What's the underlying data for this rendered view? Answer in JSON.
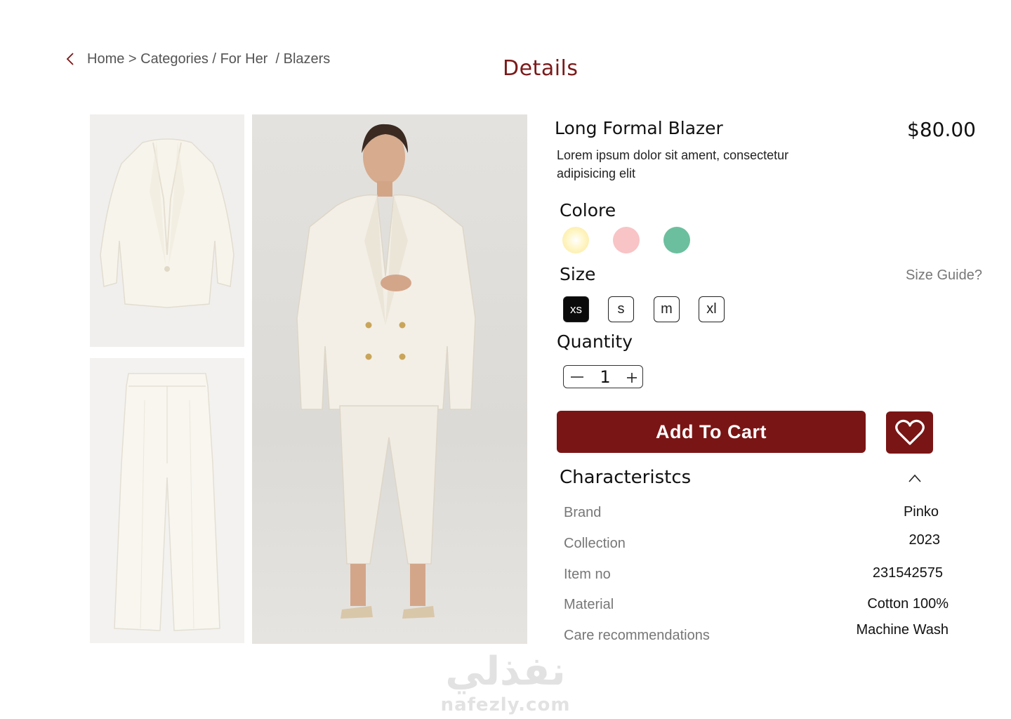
{
  "breadcrumb": {
    "items": [
      "Home >",
      "Categories /",
      "For Her",
      "/ Blazers"
    ]
  },
  "page": {
    "title": "Details"
  },
  "product": {
    "name": "Long Formal Blazer",
    "price": "$80.00",
    "description": "Lorem ipsum dolor sit ament, consectetur adipisicing elit"
  },
  "colors": {
    "label": "Colore",
    "swatches": [
      "#fdf0b0",
      "#f8c4c6",
      "#6cbf9e"
    ]
  },
  "sizes": {
    "label": "Size",
    "guide_link": "Size Guide?",
    "options": [
      "xs",
      "s",
      "m",
      "xl"
    ],
    "selected": "xs"
  },
  "quantity": {
    "label": "Quantity",
    "value": "1"
  },
  "actions": {
    "add_to_cart": "Add To Cart"
  },
  "characteristics": {
    "title": "Characteristcs",
    "rows": [
      {
        "label": "Brand",
        "value": "Pinko"
      },
      {
        "label": "Collection",
        "value": "2023"
      },
      {
        "label": "Item no",
        "value": "231542575"
      },
      {
        "label": "Material",
        "value": "Cotton 100%"
      },
      {
        "label": "Care recommendations",
        "value": "Machine Wash"
      }
    ]
  },
  "watermark": {
    "arabic": "نفذلي",
    "latin": "nafezly.com"
  },
  "theme": {
    "accent": "#7a1515",
    "title_color": "#7a1a1a"
  }
}
